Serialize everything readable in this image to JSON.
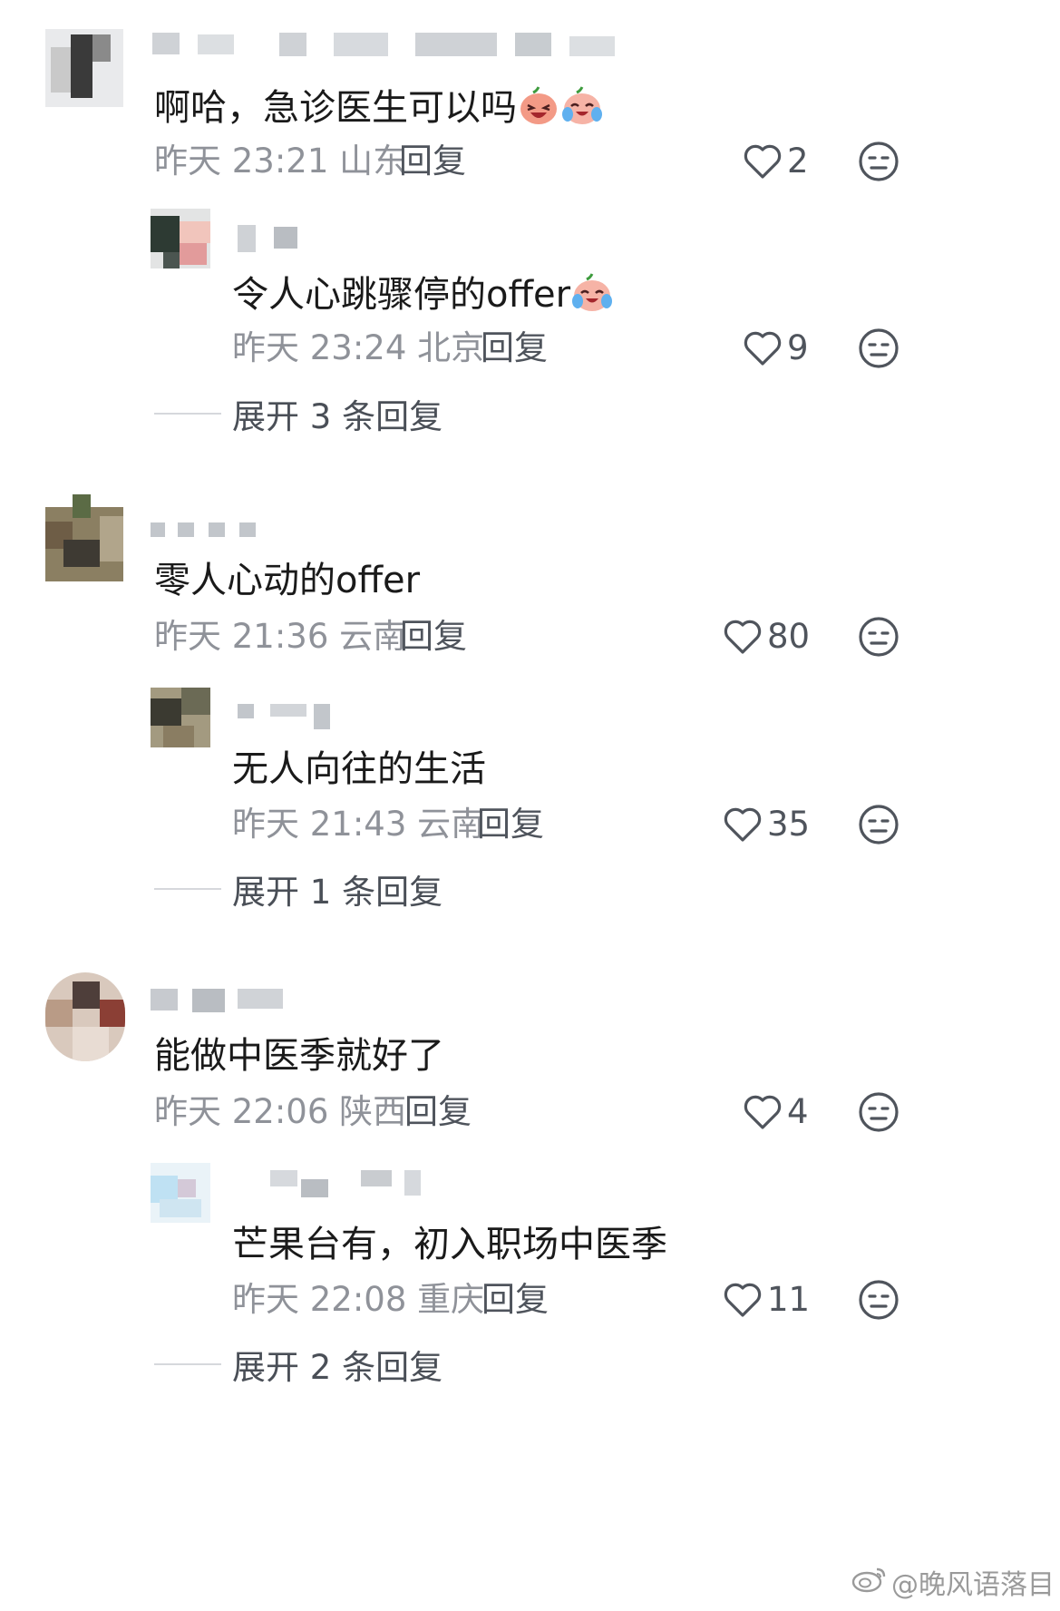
{
  "comments": [
    {
      "text": "啊哈，急诊医生可以吗",
      "emojis": [
        "laughing-tear-emoji",
        "crying-laugh-emoji"
      ],
      "time": "昨天 23:21",
      "location": "山东",
      "reply_label": "回复",
      "likes": "2",
      "reply": {
        "text": "令人心跳骤停的offer",
        "emojis": [
          "crying-laugh-emoji"
        ],
        "time": "昨天 23:24",
        "location": "北京",
        "reply_label": "回复",
        "likes": "9"
      },
      "expand_label": "展开 3 条回复"
    },
    {
      "text": "零人心动的offer",
      "time": "昨天 21:36",
      "location": "云南",
      "reply_label": "回复",
      "likes": "80",
      "reply": {
        "text": "无人向往的生活",
        "time": "昨天 21:43",
        "location": "云南",
        "reply_label": "回复",
        "likes": "35"
      },
      "expand_label": "展开 1 条回复"
    },
    {
      "text": "能做中医季就好了",
      "time": "昨天 22:06",
      "location": "陕西",
      "reply_label": "回复",
      "likes": "4",
      "reply": {
        "text": "芒果台有，初入职场中医季",
        "time": "昨天 22:08",
        "location": "重庆",
        "reply_label": "回复",
        "likes": "11"
      },
      "expand_label": "展开 2 条回复"
    }
  ],
  "watermark": "@晚风语落目",
  "colors": {
    "text": "#1a1a1a",
    "meta": "#8f9299",
    "action": "#4f545c",
    "background": "#ffffff"
  }
}
